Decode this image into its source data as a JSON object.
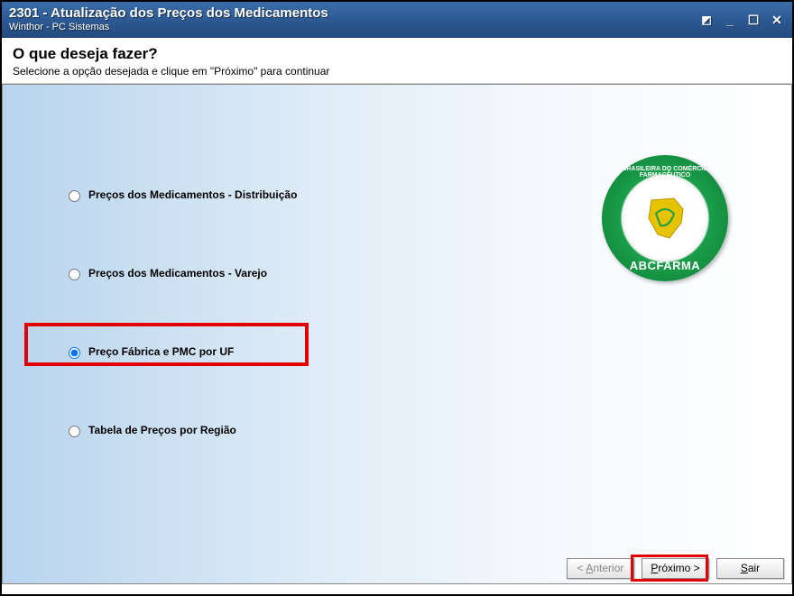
{
  "window": {
    "title": "2301 - Atualização dos Preços dos Medicamentos",
    "subtitle": "Winthor - PC Sistemas"
  },
  "header": {
    "question": "O que deseja fazer?",
    "instruction": "Selecione a opção desejada e clique em \"Próximo\" para continuar"
  },
  "options": [
    {
      "label": "Preços dos Medicamentos - Distribuição",
      "selected": false
    },
    {
      "label": "Preços dos Medicamentos - Varejo",
      "selected": false
    },
    {
      "label": "Preço Fábrica e PMC por UF",
      "selected": true
    },
    {
      "label": "Tabela de Preços por Região",
      "selected": false
    }
  ],
  "logo": {
    "top_text": "BRASILEIRA DO COMÉRCIO FARMACÊUTICO",
    "bottom_text": "ABCFARMA"
  },
  "buttons": {
    "prev_prefix": "< ",
    "prev_letter": "A",
    "prev_rest": "nterior",
    "next_letter": "P",
    "next_rest": "róximo >",
    "exit_letter": "S",
    "exit_rest": "air"
  }
}
